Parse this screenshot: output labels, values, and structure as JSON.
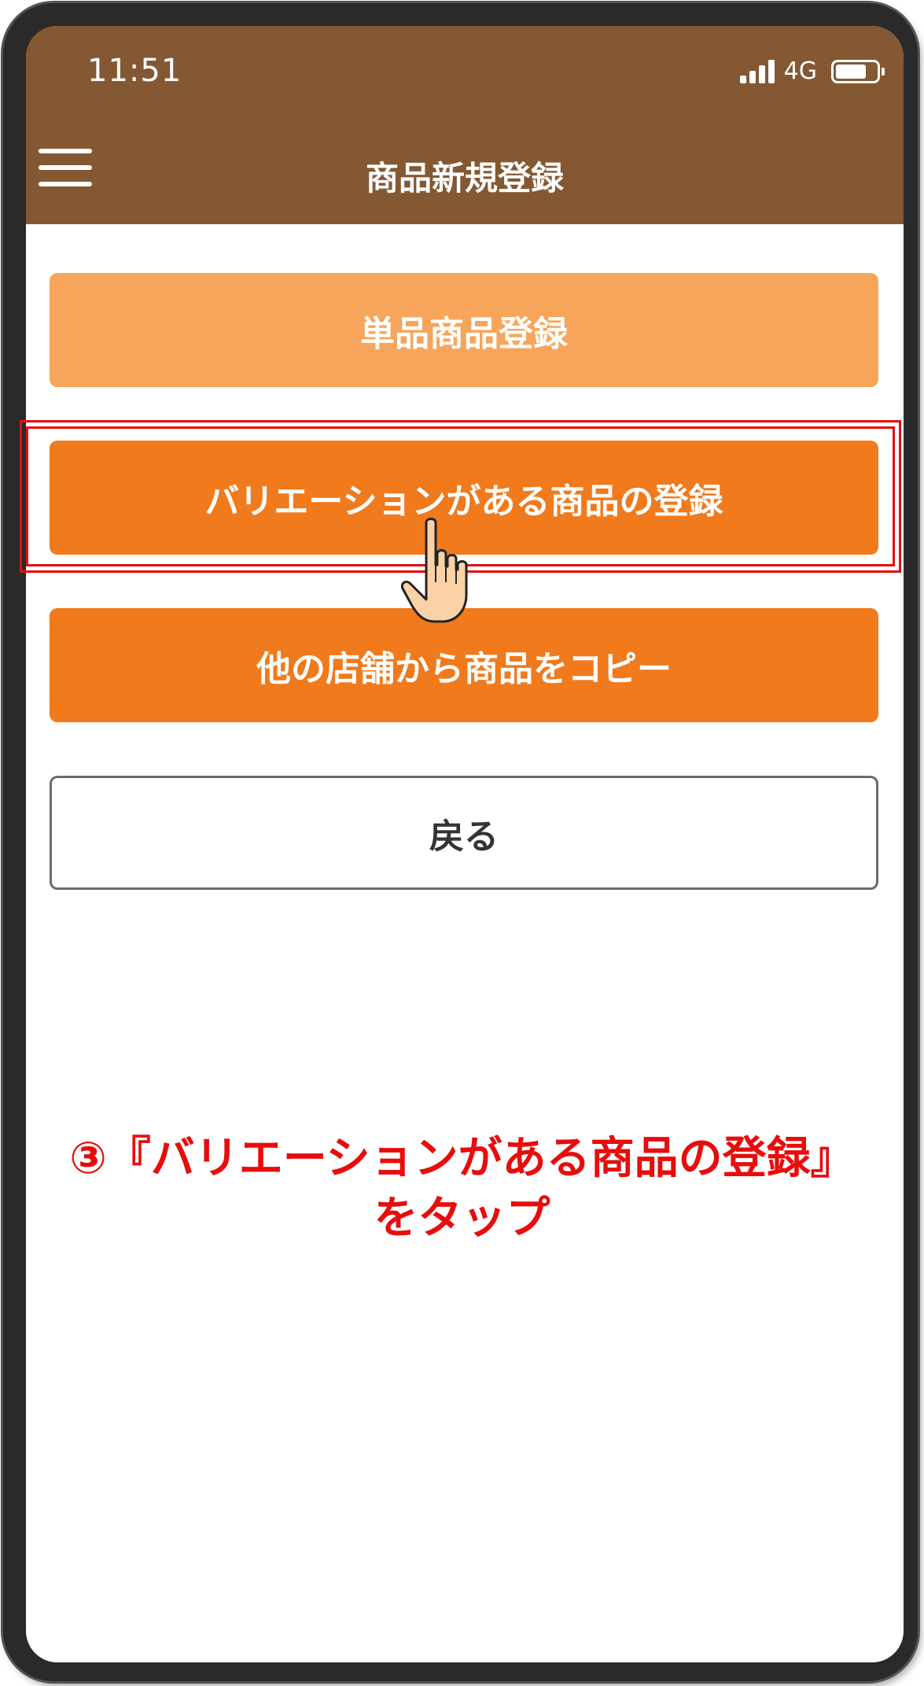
{
  "status_bar": {
    "time": "11:51",
    "network": "4G"
  },
  "header": {
    "title": "商品新規登録",
    "background_color": "#835832"
  },
  "buttons": {
    "single": "単品商品登録",
    "variation": "バリエーションがある商品の登録",
    "copy": "他の店舗から商品をコピー",
    "back": "戻る"
  },
  "instruction": {
    "line1": "③『バリエーションがある商品の登録』",
    "line2": "をタップ",
    "color": "#e80c0c"
  },
  "colors": {
    "light_orange": "#f7a55a",
    "orange": "#f07a1c",
    "highlight_red": "#e01010"
  },
  "icons": {
    "menu": "hamburger-menu-icon",
    "signal": "signal-strength-icon",
    "battery": "battery-icon",
    "pointer": "pointing-hand-icon"
  }
}
